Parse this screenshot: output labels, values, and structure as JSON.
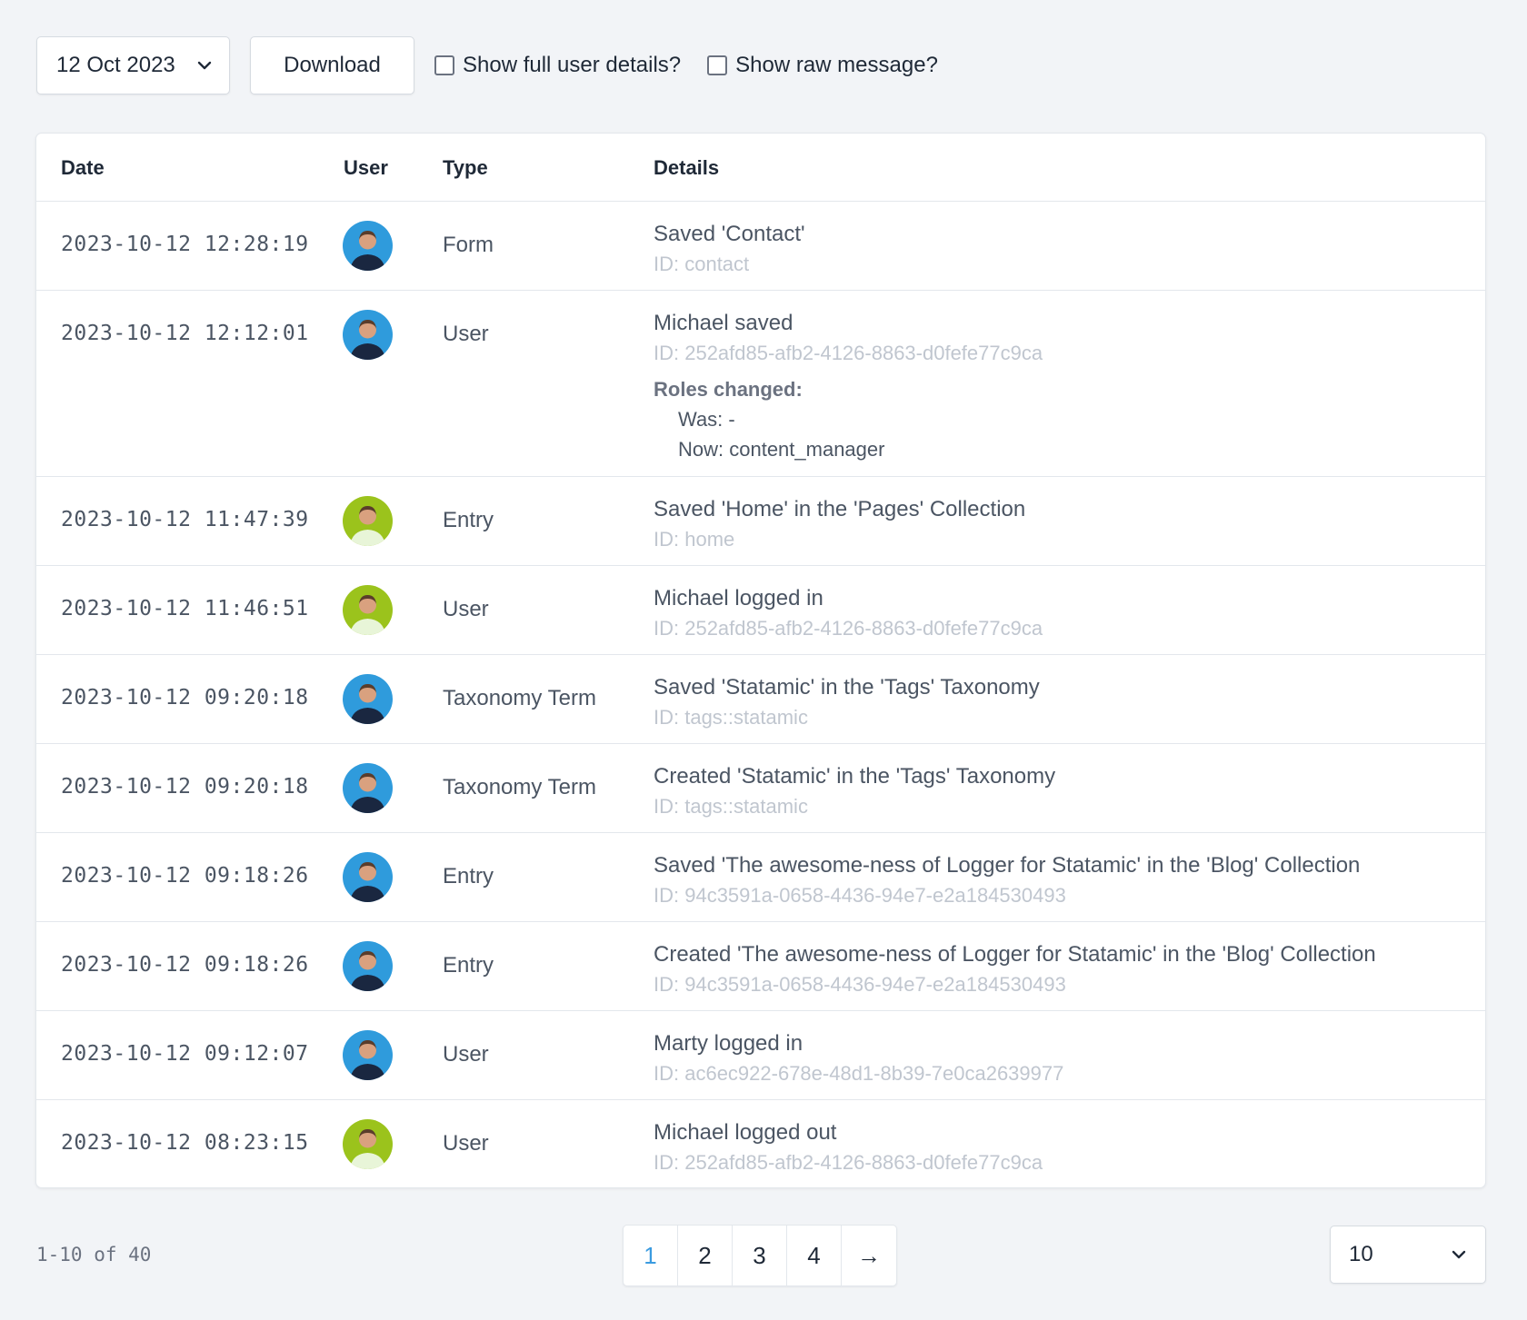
{
  "toolbar": {
    "date_value": "12 Oct 2023",
    "download_label": "Download",
    "show_full_user_label": "Show full user details?",
    "show_raw_label": "Show raw message?"
  },
  "table": {
    "headers": {
      "date": "Date",
      "user": "User",
      "type": "Type",
      "details": "Details"
    },
    "rows": [
      {
        "date": "2023-10-12 12:28:19",
        "avatar": "blue",
        "type": "Form",
        "main": "Saved 'Contact'",
        "id": "ID: contact"
      },
      {
        "date": "2023-10-12 12:12:01",
        "avatar": "blue",
        "type": "User",
        "main": "Michael saved",
        "id": "ID: 252afd85-afb2-4126-8863-d0fefe77c9ca",
        "roles_title": "Roles changed:",
        "roles_was": "Was: -",
        "roles_now": "Now: content_manager"
      },
      {
        "date": "2023-10-12 11:47:39",
        "avatar": "green",
        "type": "Entry",
        "main": "Saved 'Home' in the 'Pages' Collection",
        "id": "ID: home"
      },
      {
        "date": "2023-10-12 11:46:51",
        "avatar": "green",
        "type": "User",
        "main": "Michael logged in",
        "id": "ID: 252afd85-afb2-4126-8863-d0fefe77c9ca"
      },
      {
        "date": "2023-10-12 09:20:18",
        "avatar": "blue",
        "type": "Taxonomy Term",
        "main": "Saved 'Statamic' in the 'Tags' Taxonomy",
        "id": "ID: tags::statamic"
      },
      {
        "date": "2023-10-12 09:20:18",
        "avatar": "blue",
        "type": "Taxonomy Term",
        "main": "Created 'Statamic' in the 'Tags' Taxonomy",
        "id": "ID: tags::statamic"
      },
      {
        "date": "2023-10-12 09:18:26",
        "avatar": "blue",
        "type": "Entry",
        "main": "Saved 'The awesome-ness of Logger for Statamic' in the 'Blog' Collection",
        "id": "ID: 94c3591a-0658-4436-94e7-e2a184530493"
      },
      {
        "date": "2023-10-12 09:18:26",
        "avatar": "blue",
        "type": "Entry",
        "main": "Created 'The awesome-ness of Logger for Statamic' in the 'Blog' Collection",
        "id": "ID: 94c3591a-0658-4436-94e7-e2a184530493"
      },
      {
        "date": "2023-10-12 09:12:07",
        "avatar": "blue",
        "type": "User",
        "main": "Marty logged in",
        "id": "ID: ac6ec922-678e-48d1-8b39-7e0ca2639977"
      },
      {
        "date": "2023-10-12 08:23:15",
        "avatar": "green",
        "type": "User",
        "main": "Michael logged out",
        "id": "ID: 252afd85-afb2-4126-8863-d0fefe77c9ca"
      }
    ]
  },
  "footer": {
    "count": "1-10 of 40",
    "pages": [
      "1",
      "2",
      "3",
      "4"
    ],
    "next_arrow": "→",
    "active_page": "1",
    "per_page_value": "10"
  },
  "colors": {
    "accent": "#3b9be0",
    "avatar_blue_bg": "#2f9bdc",
    "avatar_green_bg": "#9bc31c"
  },
  "icons": {
    "dropdown": "chevron-down-icon",
    "next": "arrow-right-icon"
  }
}
